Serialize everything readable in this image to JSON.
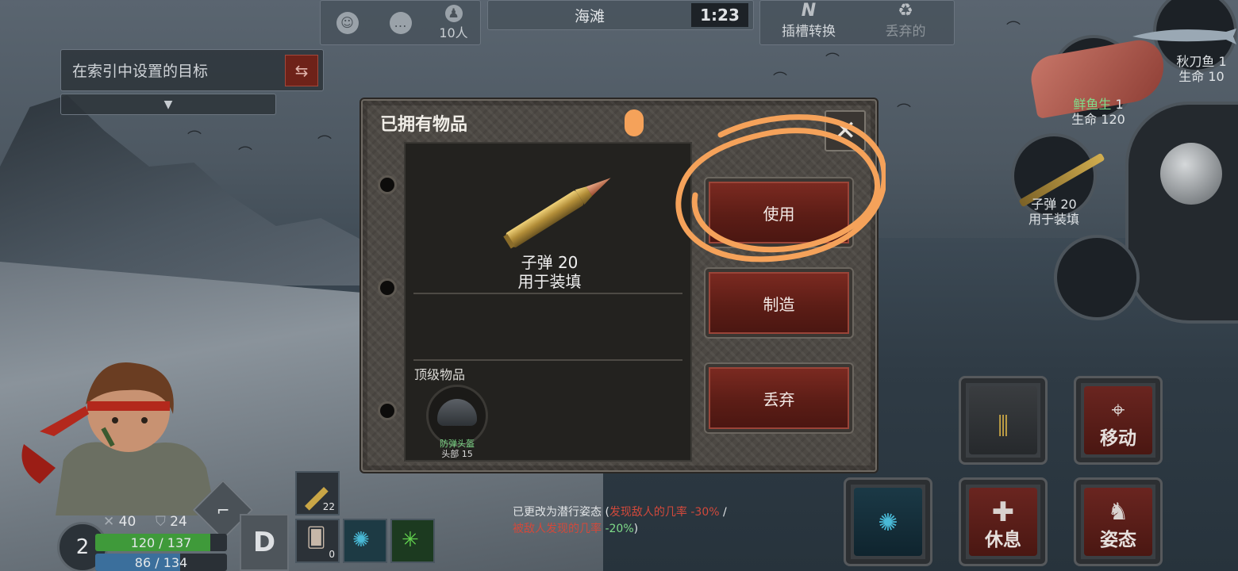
{
  "top_bar": {
    "players_count": "10人",
    "location": "海滩",
    "timer": "1:23",
    "slot_switch_label": "插槽转换",
    "discard_label": "丢弃的",
    "slot_switch_glyph": "N"
  },
  "target": {
    "label": "在索引中设置的目标"
  },
  "dialog": {
    "title": "已拥有物品",
    "item_name": "子弹 20",
    "item_desc": "用于装填",
    "top_items_label": "顶级物品",
    "helmet_name": "防弹头盔",
    "helmet_stat": "头部 15",
    "use_label": "使用",
    "craft_label": "制造",
    "discard_label": "丢弃"
  },
  "stealth_message": {
    "line1_prefix": "已更改为潜行姿态 (",
    "line1_red": "发现敌人的几率 -30%",
    "line1_suffix": " /",
    "line2_red": "被敌人发现的几率",
    "line2_green": " -20%",
    "line2_suffix": ")"
  },
  "player": {
    "attack": "40",
    "defense": "24",
    "level": "2",
    "hp_text": "120 / 137",
    "hp_fraction": 0.876,
    "stamina_text": "86 / 134",
    "stamina_fraction": 0.642,
    "grade": "D",
    "ammo_slot_count": "22",
    "cards_slot_count": "0"
  },
  "quick_items": {
    "saury_name": "秋刀鱼",
    "saury_count": "1",
    "saury_life": "生命 10",
    "fish_name": "鲜鱼生",
    "fish_count": "1",
    "fish_life": "生命 120",
    "bullet_name": "子弹 20",
    "bullet_desc": "用于装填"
  },
  "actions": {
    "move": "移动",
    "rest": "休息",
    "stance": "姿态"
  },
  "colors": {
    "accent_orange": "#f5a25a",
    "button_red": "#7c2a21",
    "hp_green": "#3f9a3a",
    "stamina_blue": "#3b6f9c",
    "stealth_red": "#d2493b",
    "stealth_green": "#7fdc8a"
  },
  "icons": [
    "smile-icon",
    "chat-icon",
    "players-icon",
    "swap-icon",
    "dropdown-icon",
    "close-icon",
    "bullet-icon",
    "helmet-icon",
    "sword-icon",
    "shield-icon",
    "pistol-icon",
    "brain-icon",
    "virus-icon",
    "map-pin-icon",
    "medkit-icon",
    "stance-icon",
    "ammo-box-icon"
  ]
}
